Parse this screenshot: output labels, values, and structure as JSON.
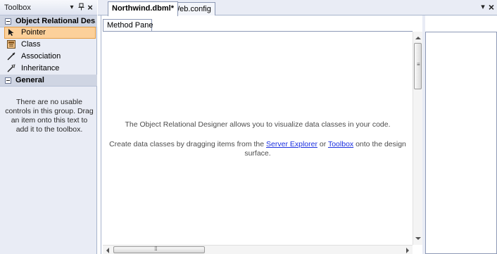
{
  "toolbox": {
    "title": "Toolbox",
    "title_buttons": {
      "dropdown": "▾",
      "pin": "ᵺ",
      "close": "×"
    },
    "groups": [
      {
        "label": "Object Relational Des...",
        "items": [
          {
            "label": "Pointer",
            "icon": "pointer-icon",
            "selected": true
          },
          {
            "label": "Class",
            "icon": "class-icon",
            "selected": false
          },
          {
            "label": "Association",
            "icon": "association-icon",
            "selected": false
          },
          {
            "label": "Inheritance",
            "icon": "inheritance-icon",
            "selected": false
          }
        ]
      },
      {
        "label": "General",
        "empty_text": "There are no usable controls in this group. Drag an item onto this text to add it to the toolbox."
      }
    ]
  },
  "tabs": [
    {
      "label": "Northwind.dbml*",
      "active": true
    },
    {
      "label": "Web.config",
      "active": false
    }
  ],
  "tabstrip_buttons": {
    "dropdown": "▾",
    "close": "×"
  },
  "designer": {
    "pane_tab": "Method Pane",
    "message_line1": "The Object Relational Designer allows you to visualize data classes in your code.",
    "message_line2_prefix": "Create data classes by dragging items from the ",
    "link_server_explorer": "Server Explorer",
    "message_line2_mid": " or ",
    "link_toolbox": "Toolbox",
    "message_line2_suffix": " onto the design",
    "message_line3": "surface."
  },
  "colors": {
    "selected_fill": "#fcd09a",
    "selected_border": "#e49c45",
    "link": "#1a2fe0",
    "panel_bg": "#e9ecf5"
  }
}
